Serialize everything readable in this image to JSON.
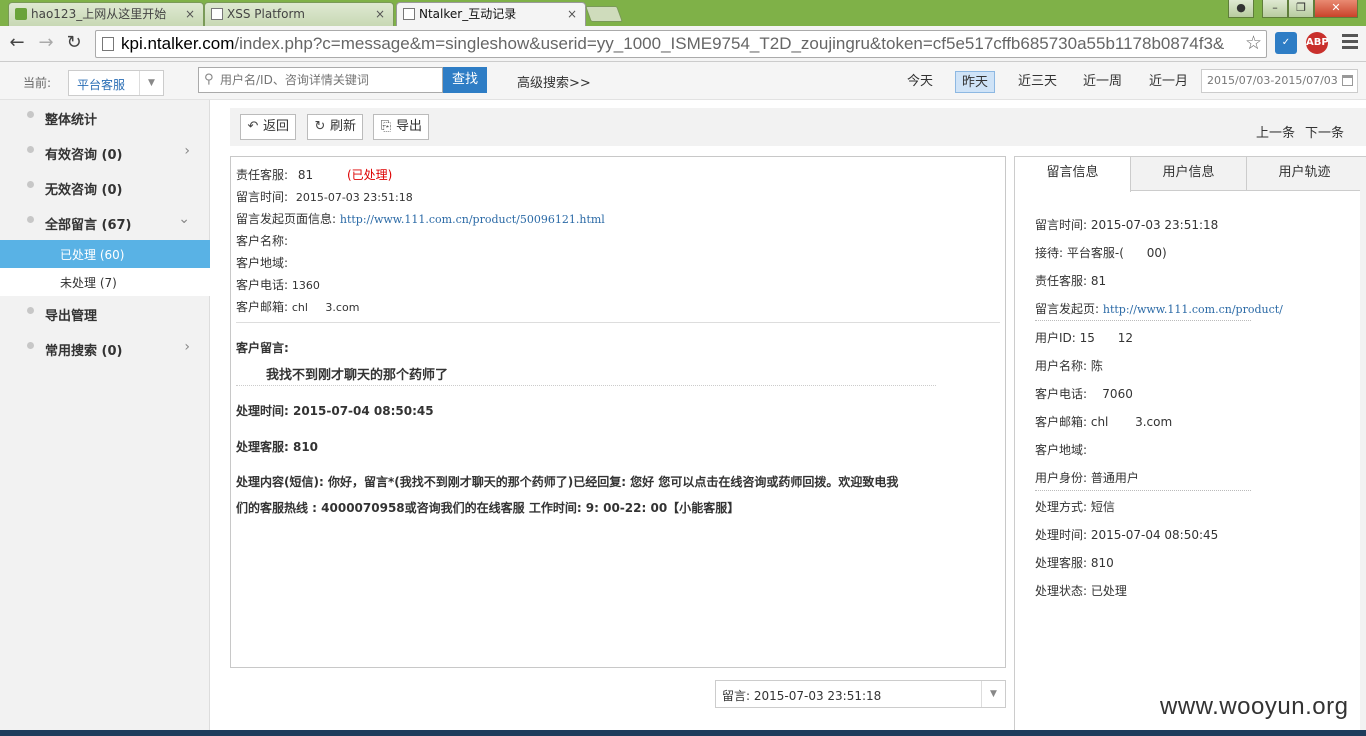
{
  "browser": {
    "tabs": [
      {
        "title": "hao123_上网从这里开始",
        "active": false
      },
      {
        "title": "XSS Platform",
        "active": false
      },
      {
        "title": "Ntalker_互动记录",
        "active": true
      }
    ],
    "tab_close": "×",
    "url_host": "kpi.ntalker.com",
    "url_rest": "/index.php?c=message&m=singleshow&userid=yy_1000_ISME9754_T2D_zoujingru&token=cf5e517cffb685730a55b1178b0874f3&",
    "ext_abp": "ABP"
  },
  "appbar": {
    "current_label": "当前:",
    "scope_value": "平台客服",
    "search_placeholder": "用户名/ID、咨询详情关键词",
    "search_button": "查找",
    "advanced_search": "高级搜索>>",
    "date_tabs": [
      "今天",
      "昨天",
      "近三天",
      "近一周",
      "近一月"
    ],
    "date_active": "昨天",
    "date_range": "2015/07/03-2015/07/03"
  },
  "sidebar": {
    "items": [
      {
        "label": "整体统计"
      },
      {
        "label": "有效咨询 (0)"
      },
      {
        "label": "无效咨询 (0)"
      },
      {
        "label": "全部留言 (67)"
      },
      {
        "label": "导出管理"
      },
      {
        "label": "常用搜索 (0)"
      }
    ],
    "sub": [
      {
        "label": "已处理 (60)",
        "active": true
      },
      {
        "label": "未处理 (7)",
        "active": false
      }
    ]
  },
  "toolbar": {
    "back": "返回",
    "refresh": "刷新",
    "export": "导出",
    "prev": "上一条",
    "next": "下一条"
  },
  "detail": {
    "owner_label": "责任客服:",
    "owner_value": "81",
    "owner_status": "(已处理)",
    "time_label": "留言时间:",
    "time_value": "2015-07-03 23:51:18",
    "page_label": "留言发起页面信息:",
    "page_value": "http://www.111.com.cn/product/50096121.html",
    "name_label": "客户名称:",
    "region_label": "客户地域:",
    "phone_label": "客户电话:",
    "phone_value": "1360",
    "email_label": "客户邮箱:",
    "email_value": "chl     3.com",
    "message_label": "客户留言:",
    "message_body": "我找不到刚才聊天的那个药师了",
    "handle_time": "处理时间: 2015-07-04 08:50:45",
    "handler": "处理客服: 810",
    "reply_line1": "处理内容(短信): 你好，留言*(我找不到刚才聊天的那个药师了)已经回复: 您好 您可以点击在线咨询或药师回拨。欢迎致电我",
    "reply_line2": "们的客服热线 : 4000070958或咨询我们的在线客服 工作时间: 9: 00-22: 00【小能客服】",
    "bottom_select": "留言: 2015-07-03 23:51:18"
  },
  "right_panel": {
    "tabs": [
      "留言信息",
      "用户信息",
      "用户轨迹"
    ],
    "rows": [
      "留言时间: 2015-07-03 23:51:18",
      "接待: 平台客服-(      00)",
      "责任客服: 81",
      "留言发起页: ",
      "用户ID: 15      12",
      "用户名称: 陈",
      "客户电话:    7060",
      "客户邮箱: chl       3.com",
      "客户地域:",
      "用户身份: 普通用户",
      "处理方式: 短信",
      "处理时间: 2015-07-04 08:50:45",
      "处理客服: 810",
      "处理状态: 已处理"
    ],
    "page_link": "http://www.111.com.cn/product/"
  },
  "watermark": "www.wooyun.org"
}
